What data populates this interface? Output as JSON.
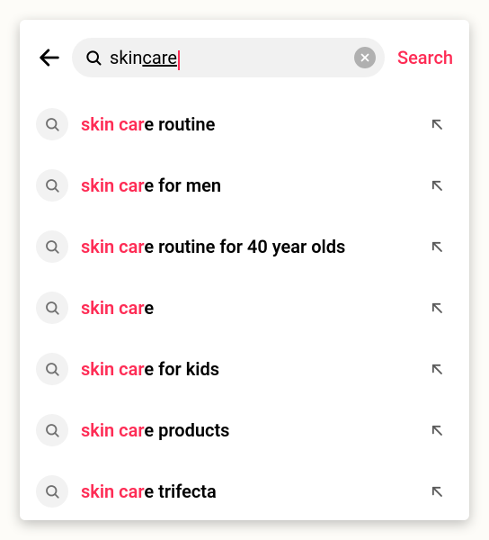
{
  "search": {
    "query_prefix": "skin ",
    "query_underlined": "care",
    "search_button_label": "Search",
    "highlight": "skin car"
  },
  "suggestions": [
    {
      "prefix": "skin car",
      "rest": "e routine"
    },
    {
      "prefix": "skin car",
      "rest": "e for men"
    },
    {
      "prefix": "skin car",
      "rest": "e routine for 40 year olds"
    },
    {
      "prefix": "skin car",
      "rest": "e"
    },
    {
      "prefix": "skin car",
      "rest": "e for kids"
    },
    {
      "prefix": "skin car",
      "rest": "e products"
    },
    {
      "prefix": "skin car",
      "rest": "e trifecta"
    }
  ]
}
